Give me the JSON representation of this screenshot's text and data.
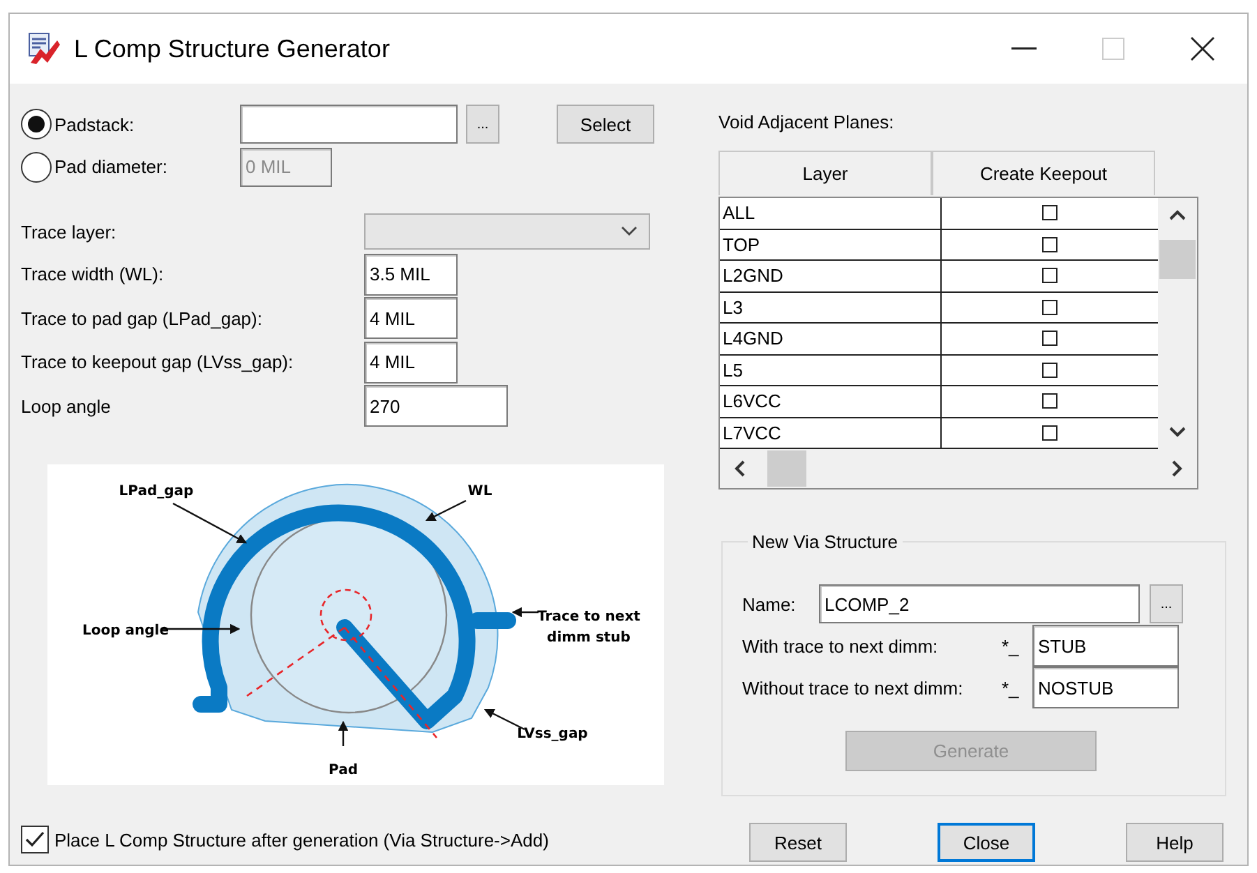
{
  "window": {
    "title": "L Comp Structure Generator"
  },
  "source": {
    "options": [
      {
        "label": "Padstack:",
        "selected": true
      },
      {
        "label": "Pad diameter:",
        "selected": false
      }
    ],
    "browse_button": "...",
    "select_button": "Select",
    "pad_diameter": {
      "value": "0 MIL",
      "disabled": true
    }
  },
  "trace": {
    "layer": {
      "label": "Trace layer:",
      "disabled": true
    },
    "fields": [
      {
        "label": "Trace width (WL):",
        "value": "3.5 MIL"
      },
      {
        "label": "Trace to pad gap (LPad_gap):",
        "value": "4 MIL"
      },
      {
        "label": "Trace to keepout gap (LVss_gap):",
        "value": "4 MIL"
      },
      {
        "label": "Loop angle",
        "value": "270"
      }
    ]
  },
  "diagram": {
    "labels": [
      "LPad_gap",
      "WL",
      "Loop angle",
      "Trace to next",
      "dimm stub",
      "LVss_gap",
      "Pad"
    ]
  },
  "void_planes": {
    "title": "Void Adjacent Planes:",
    "columns": [
      "Layer",
      "Create Keepout"
    ],
    "rows": [
      {
        "layer": "ALL",
        "checked": false
      },
      {
        "layer": "TOP",
        "checked": false
      },
      {
        "layer": "L2GND",
        "checked": false
      },
      {
        "layer": "L3",
        "checked": false
      },
      {
        "layer": "L4GND",
        "checked": false
      },
      {
        "layer": "L5",
        "checked": false
      },
      {
        "layer": "L6VCC",
        "checked": false
      },
      {
        "layer": "L7VCC",
        "checked": false
      }
    ]
  },
  "new_via": {
    "title": "New Via Structure",
    "name_label": "Name:",
    "name_value": "LCOMP_2",
    "browse_button": "...",
    "suffixes": [
      {
        "label": "With trace to next dimm:",
        "prefix": "*_",
        "value": "STUB"
      },
      {
        "label": "Without trace to next dimm:",
        "prefix": "*_",
        "value": "NOSTUB"
      }
    ],
    "generate": {
      "label": "Generate",
      "disabled": true
    }
  },
  "place_after": {
    "label": "Place L Comp Structure after generation (Via Structure->Add)",
    "checked": true
  },
  "buttons": [
    {
      "label": "Reset",
      "focused": false
    },
    {
      "label": "Close",
      "focused": true
    },
    {
      "label": "Help",
      "focused": false
    }
  ]
}
